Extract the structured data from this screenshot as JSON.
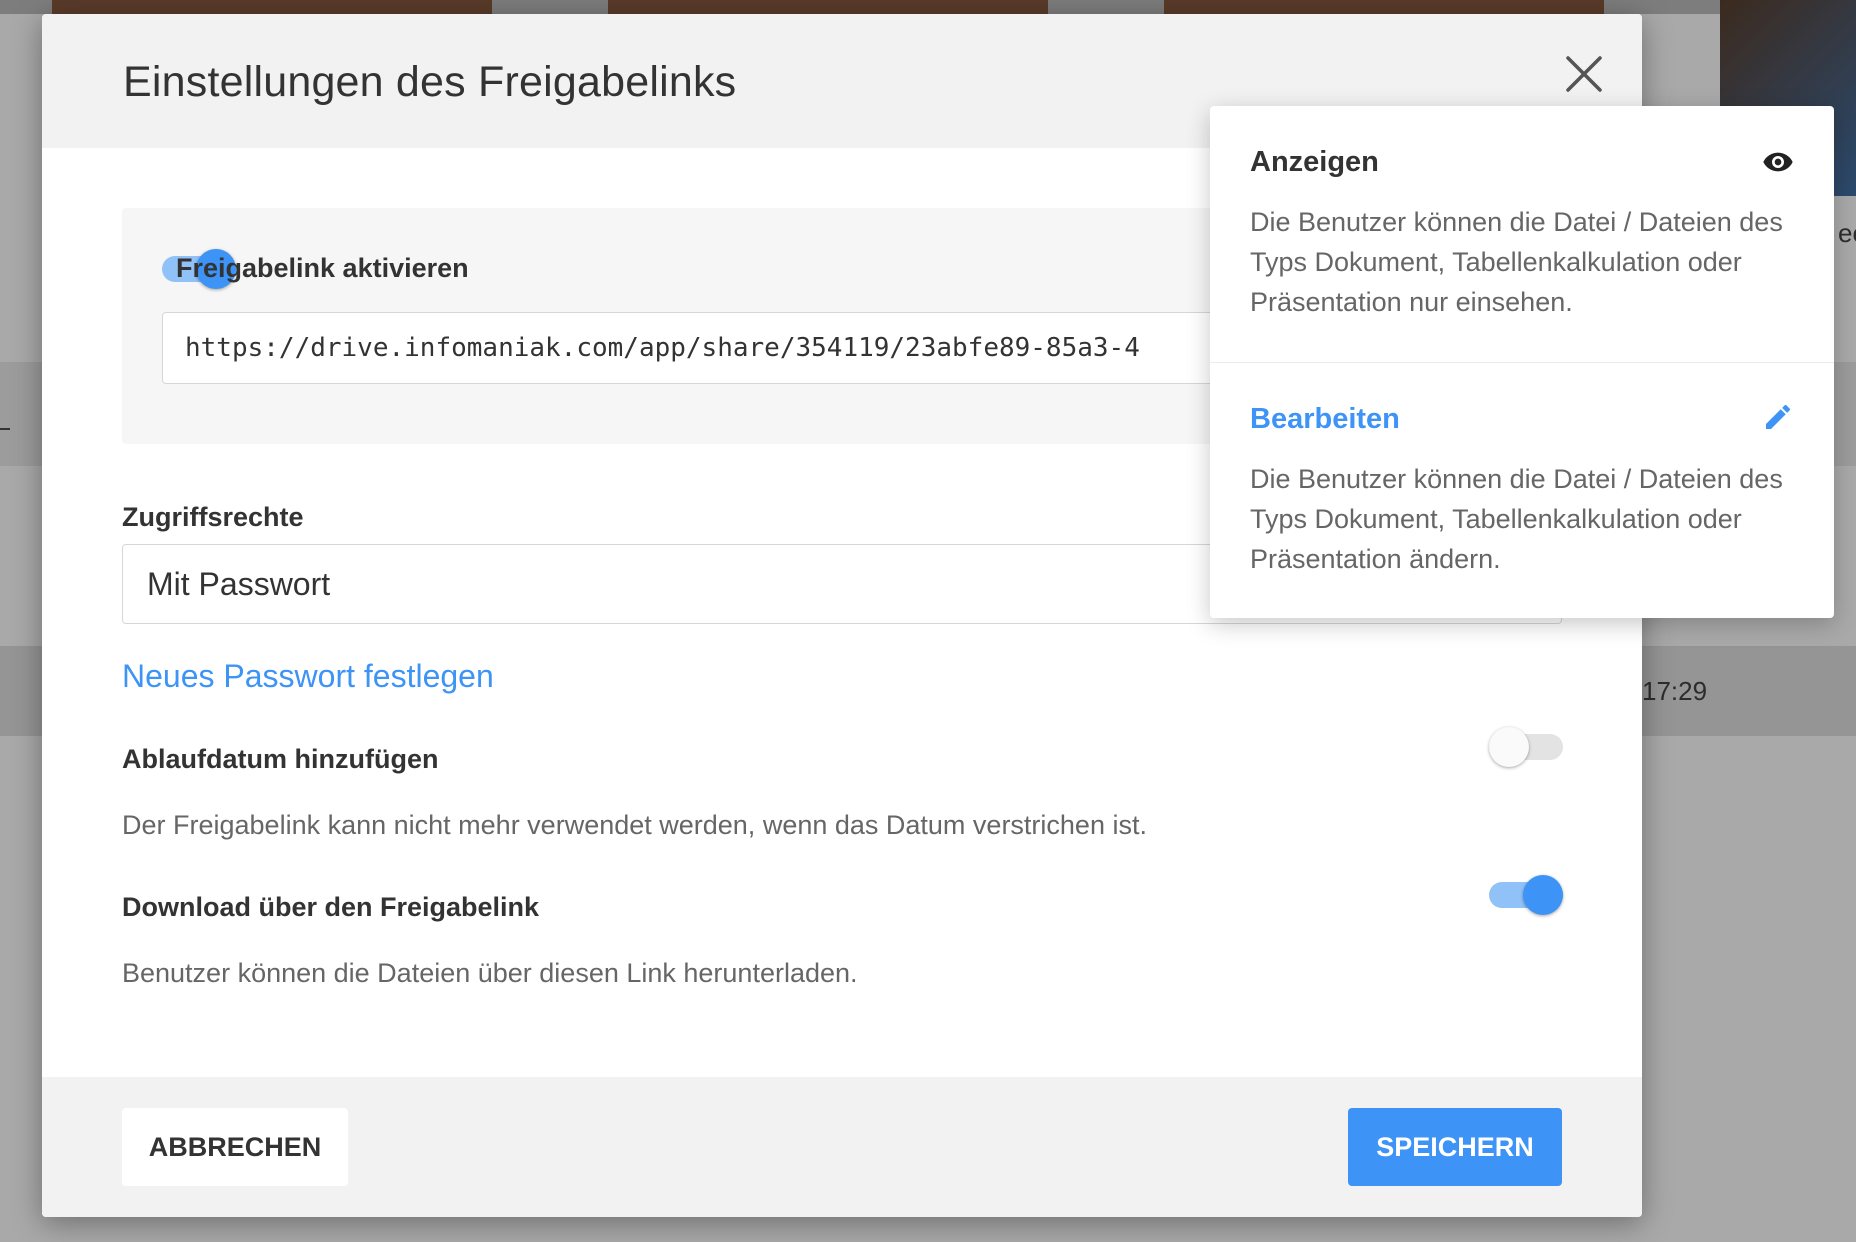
{
  "background": {
    "time_text": "17:29",
    "side_text": "eo"
  },
  "dialog": {
    "title": "Einstellungen des Freigabelinks",
    "close_icon": "close-icon",
    "share_link": {
      "toggle_label": "Freigabelink aktivieren",
      "enabled": true,
      "url": "https://drive.infomaniak.com/app/share/354119/23abfe89-85a3-4"
    },
    "access": {
      "label": "Zugriffsrechte",
      "selected": "Mit Passwort",
      "new_password_link": "Neues Passwort festlegen"
    },
    "expiration": {
      "label": "Ablaufdatum hinzufügen",
      "enabled": false,
      "description": "Der Freigabelink kann nicht mehr verwendet werden, wenn das Datum verstrichen ist."
    },
    "download": {
      "label": "Download über den Freigabelink",
      "enabled": true,
      "description": "Benutzer können die Dateien über diesen Link herunterladen."
    },
    "footer": {
      "cancel_label": "ABBRECHEN",
      "save_label": "SPEICHERN"
    }
  },
  "popover": {
    "options": [
      {
        "title": "Anzeigen",
        "icon": "eye-icon",
        "selected": false,
        "description": "Die Benutzer können die Datei / Dateien des Typs Dokument, Tabellenkalkulation oder Präsentation nur einsehen."
      },
      {
        "title": "Bearbeiten",
        "icon": "pencil-icon",
        "selected": true,
        "description": "Die Benutzer können die Datei / Dateien des Typs Dokument, Tabellenkalkulation oder Präsentation ändern."
      }
    ]
  },
  "colors": {
    "accent": "#3d94f6",
    "accent_light": "#90c2f8",
    "header_bg": "#f2f2f2",
    "text": "#333333",
    "muted": "#666666"
  }
}
